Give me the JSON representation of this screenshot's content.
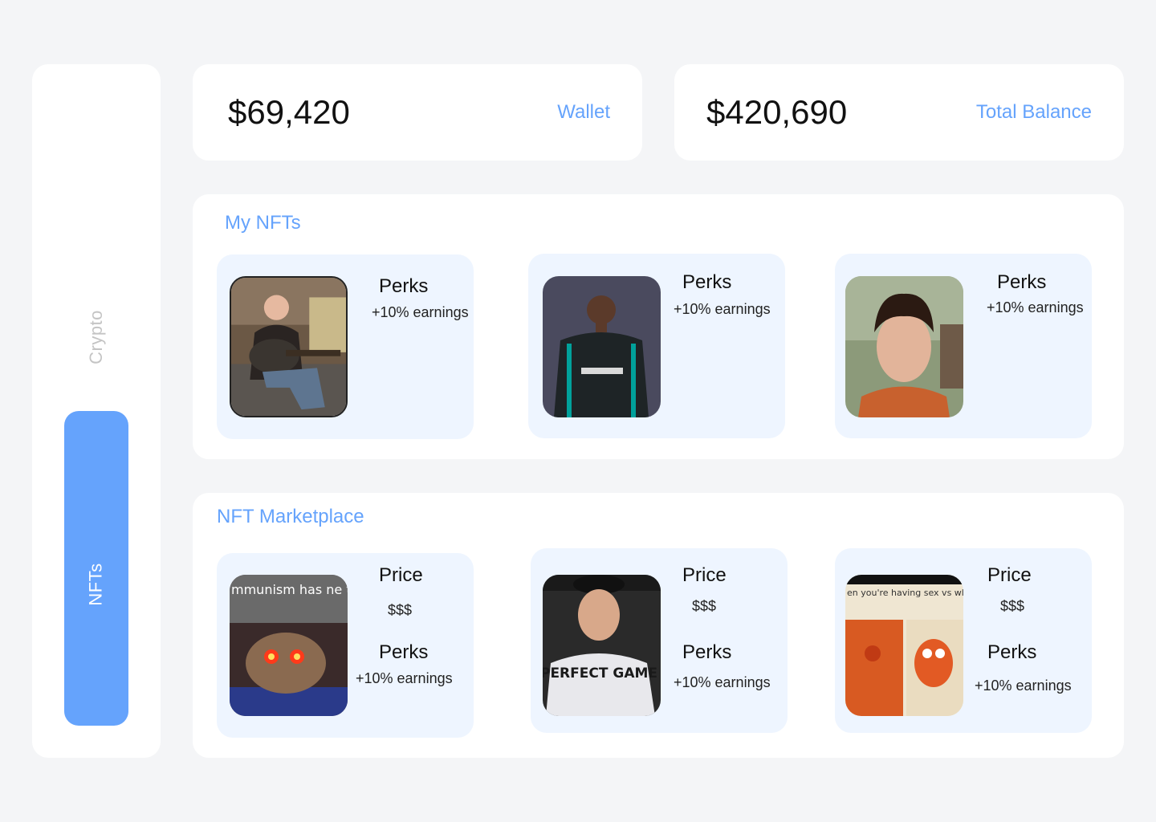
{
  "sidebar": {
    "items": [
      {
        "label": "Crypto",
        "active": false
      },
      {
        "label": "NFTs",
        "active": true
      }
    ]
  },
  "wallet": {
    "amount": "$69,420",
    "label": "Wallet"
  },
  "balance": {
    "amount": "$420,690",
    "label": "Total Balance"
  },
  "my_nfts": {
    "title": "My NFTs",
    "cards": [
      {
        "perks_label": "Perks",
        "perks_value": "+10% earnings",
        "image": "man-with-guitar-photo"
      },
      {
        "perks_label": "Perks",
        "perks_value": "+10% earnings",
        "image": "racing-driver-portrait-photo"
      },
      {
        "perks_label": "Perks",
        "perks_value": "+10% earnings",
        "image": "curly-haired-boy-selfie-photo"
      }
    ]
  },
  "marketplace": {
    "title": "NFT Marketplace",
    "cards": [
      {
        "price_label": "Price",
        "price_value": "$$$",
        "perks_label": "Perks",
        "perks_value": "+10% earnings",
        "image": "deep-fried-meme-image",
        "image_text": "mmunism has ne tried"
      },
      {
        "price_label": "Price",
        "price_value": "$$$",
        "perks_label": "Perks",
        "perks_value": "+10% earnings",
        "image": "perfect-game-boy-photo",
        "image_text": "PERFECT GAME"
      },
      {
        "price_label": "Price",
        "price_value": "$$$",
        "perks_label": "Perks",
        "perks_value": "+10% earnings",
        "image": "spongebob-meme-image",
        "image_text": "en you're having sex vs wl u're meeting her parents"
      }
    ]
  },
  "colors": {
    "accent": "#65a3fc",
    "background": "#f4f5f7",
    "card": "#ffffff",
    "nft_card": "#eef5ff"
  }
}
